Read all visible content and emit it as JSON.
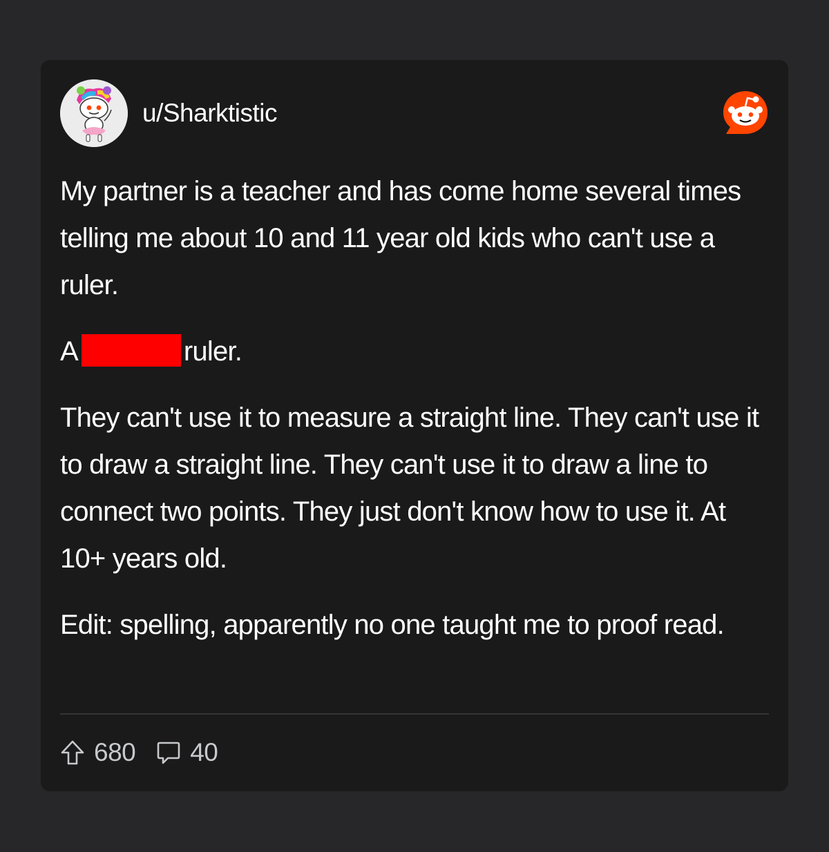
{
  "post": {
    "username": "u/Sharktistic",
    "paragraphs": {
      "p1": "My partner is a teacher and has come home several times telling me about 10 and 11 year old kids who can't use a ruler.",
      "p2_before": "A",
      "p2_after": "ruler.",
      "p3": "They can't use it to measure a straight line. They can't use it to draw a straight line. They can't use it to draw a line to connect two points. They just don't know how to use it. At 10+ years old.",
      "p4": "Edit: spelling, apparently no one taught me to proof read."
    }
  },
  "stats": {
    "upvotes": "680",
    "comments": "40"
  },
  "icons": {
    "avatar": "snoo-avatar",
    "logo": "reddit-logo-icon",
    "upvote": "upvote-arrow-icon",
    "comment": "comment-bubble-icon"
  },
  "colors": {
    "background": "#272729",
    "card": "#1a1a1b",
    "reddit_orange": "#ff4500",
    "redaction": "#ff0000",
    "meta_text": "#c7c9cc"
  }
}
